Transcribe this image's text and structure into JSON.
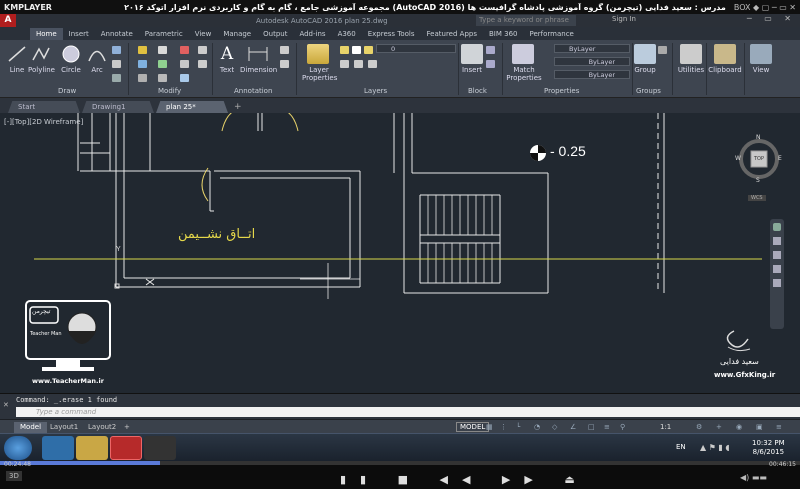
{
  "player": {
    "logo": "KMPLAYER",
    "caption": "مجموعه آموزشی جامع ، گام به گام و کاربردی نرم افزار اتوکد ۲۰۱۶ (AutoCAD 2016) مدرس : سعید فدایی (تیچرمن) گروه آموزشی پادشاه گرافیست ها",
    "controls": "BOX ◆ ▢ ─ ▭ ✕",
    "time_current": "00:24:48",
    "time_total": "00:46:15",
    "progress_fraction": 0.2
  },
  "acad": {
    "title": "Autodesk AutoCAD 2016  plan 25.dwg",
    "search_placeholder": "Type a keyword or phrase",
    "signin": "Sign In",
    "window_buttons": "─ ▭ ✕"
  },
  "ribbon_tabs": [
    "Home",
    "Insert",
    "Annotate",
    "Parametric",
    "View",
    "Manage",
    "Output",
    "Add-ins",
    "A360",
    "Express Tools",
    "Featured Apps",
    "BIM 360",
    "Performance"
  ],
  "ribbon": {
    "draw_tools": [
      "Line",
      "Polyline",
      "Circle",
      "Arc"
    ],
    "text_tool": "Text",
    "dimension_tool": "Dimension",
    "layer_properties": "Layer Properties",
    "insert": "Insert",
    "match_properties": "Match Properties",
    "group": "Group",
    "utilities": "Utilities",
    "clipboard": "Clipboard",
    "view": "View",
    "groups": [
      "Draw",
      "Modify",
      "Annotation",
      "Layers",
      "Block",
      "Properties",
      "Groups"
    ],
    "layer_value": "0",
    "bylayer": "ByLayer"
  },
  "file_tabs": [
    "Start",
    "Drawing1",
    "plan 25*"
  ],
  "viewport_label": "[-][Top][2D Wireframe]",
  "drawing": {
    "room_label": "اتــاق نشــیمن",
    "elevation": "- 0.25",
    "viewcube": {
      "top": "TOP",
      "n": "N",
      "s": "S",
      "e": "E",
      "w": "W",
      "wcs": "WCS"
    },
    "watermark_site": "www.TeacherMan.ir",
    "teacher_name": "Teacher Man",
    "logo_text": "تیچرمن",
    "gfx_name": "سعید فدایی",
    "gfx_site": "www.GfxKing.ir"
  },
  "command": {
    "history": "Command: _.erase 1 found",
    "placeholder": "Type a command"
  },
  "layout_tabs": [
    "Model",
    "Layout1",
    "Layout2"
  ],
  "status": {
    "model": "MODEL",
    "scale": "1:1"
  },
  "taskbar": {
    "lang": "EN",
    "time": "10:32 PM",
    "date": "8/6/2015"
  }
}
